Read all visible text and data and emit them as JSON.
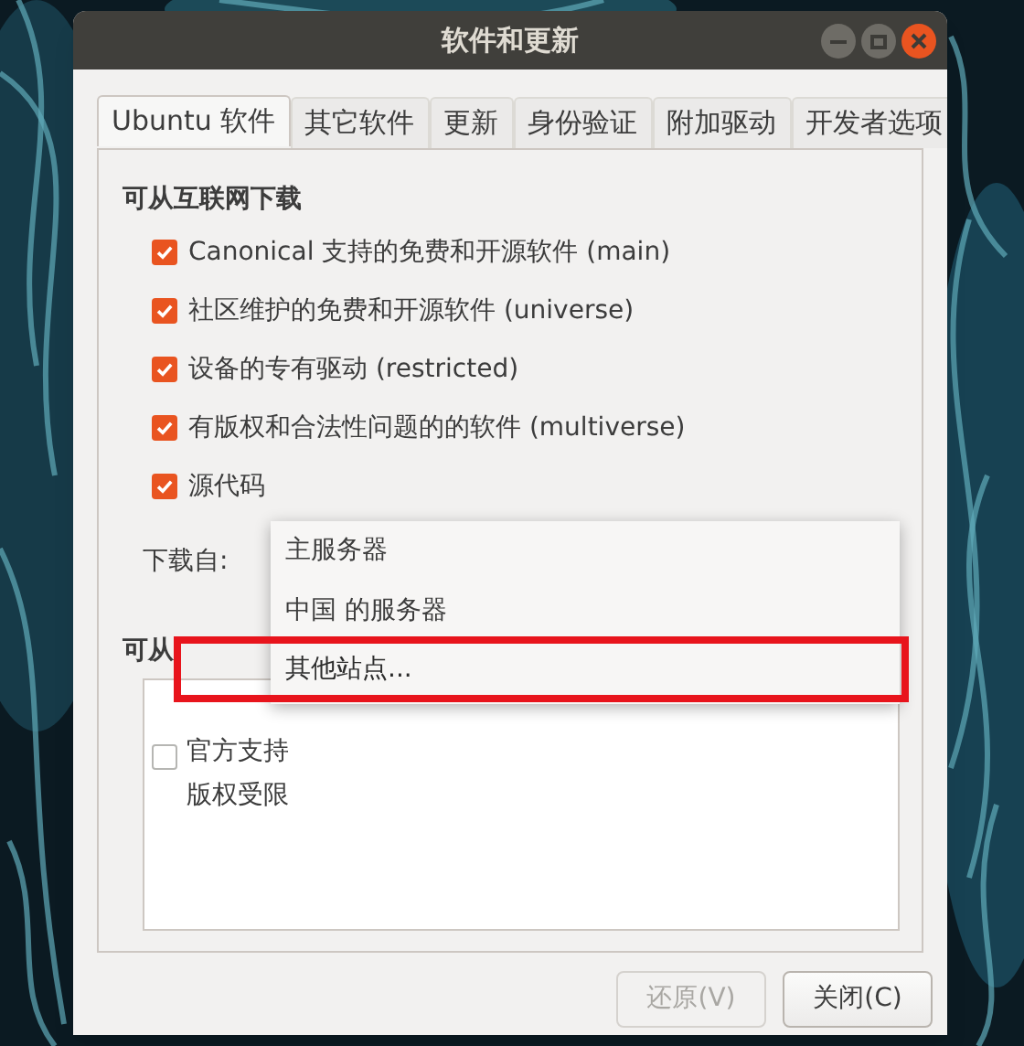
{
  "window": {
    "title": "软件和更新"
  },
  "tabs": [
    {
      "label": "Ubuntu 软件",
      "selected": true
    },
    {
      "label": "其它软件",
      "selected": false
    },
    {
      "label": "更新",
      "selected": false
    },
    {
      "label": "身份验证",
      "selected": false
    },
    {
      "label": "附加驱动",
      "selected": false
    },
    {
      "label": "开发者选项",
      "selected": false
    }
  ],
  "internet_section": {
    "heading": "可从互联网下载",
    "options": [
      {
        "label": "Canonical 支持的免费和开源软件 (main)",
        "checked": true
      },
      {
        "label": "社区维护的免费和开源软件 (universe)",
        "checked": true
      },
      {
        "label": "设备的专有驱动 (restricted)",
        "checked": true
      },
      {
        "label": "有版权和合法性问题的的软件 (multiverse)",
        "checked": true
      },
      {
        "label": "源代码",
        "checked": true
      }
    ],
    "download_from_label": "下载自:"
  },
  "cdrom_section": {
    "heading": "可从",
    "option": {
      "checked": false,
      "lines": [
        "官方支持",
        "版权受限"
      ]
    }
  },
  "dropdown_menu": {
    "items": [
      {
        "label": "主服务器",
        "highlighted": false
      },
      {
        "label": "中国 的服务器",
        "highlighted": false
      },
      {
        "label": "其他站点...",
        "highlighted": true
      }
    ]
  },
  "buttons": [
    {
      "label": "还原(V)",
      "disabled": true
    },
    {
      "label": "关闭(C)",
      "disabled": false
    }
  ]
}
